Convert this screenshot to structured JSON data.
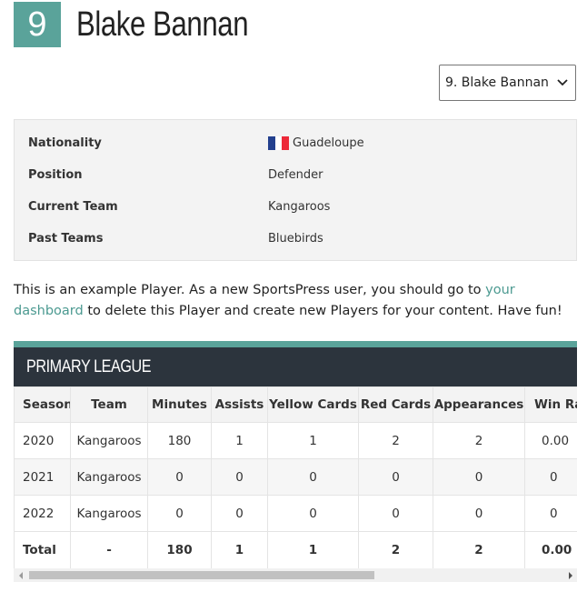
{
  "header": {
    "number": "9",
    "name": "Blake Bannan",
    "badge_color": "#5aa39a"
  },
  "player_select": {
    "selected": "9. Blake Bannan"
  },
  "details": {
    "rows": [
      {
        "label": "Nationality",
        "value": "Guadeloupe",
        "flag": "france-flag"
      },
      {
        "label": "Position",
        "value": "Defender"
      },
      {
        "label": "Current Team",
        "value": "Kangaroos"
      },
      {
        "label": "Past Teams",
        "value": "Bluebirds"
      }
    ],
    "flag_colors": [
      "#23408e",
      "#ffffff",
      "#ed2939"
    ]
  },
  "description": {
    "before_link": "This is an example Player. As a new SportsPress user, you should go to ",
    "link_text": "your dashboard",
    "after_link": " to delete this Player and create new Players for your content. Have fun!",
    "link_color": "#4c9a91"
  },
  "league": {
    "title": "PRIMARY LEAGUE",
    "accent_color": "#5aa39a",
    "title_bg": "#2c343d",
    "columns": [
      "Season",
      "Team",
      "Minutes",
      "Assists",
      "Yellow Cards",
      "Red Cards",
      "Appearances",
      "Win Ratio"
    ],
    "rows": [
      [
        "2020",
        "Kangaroos",
        "180",
        "1",
        "1",
        "2",
        "2",
        "0.00"
      ],
      [
        "2021",
        "Kangaroos",
        "0",
        "0",
        "0",
        "0",
        "0",
        "0"
      ],
      [
        "2022",
        "Kangaroos",
        "0",
        "0",
        "0",
        "0",
        "0",
        "0"
      ]
    ],
    "total": [
      "Total",
      "-",
      "180",
      "1",
      "1",
      "2",
      "2",
      "0.00"
    ]
  },
  "scrollbar": {
    "left_icon": "arrow-left-icon",
    "right_icon": "arrow-right-icon"
  }
}
